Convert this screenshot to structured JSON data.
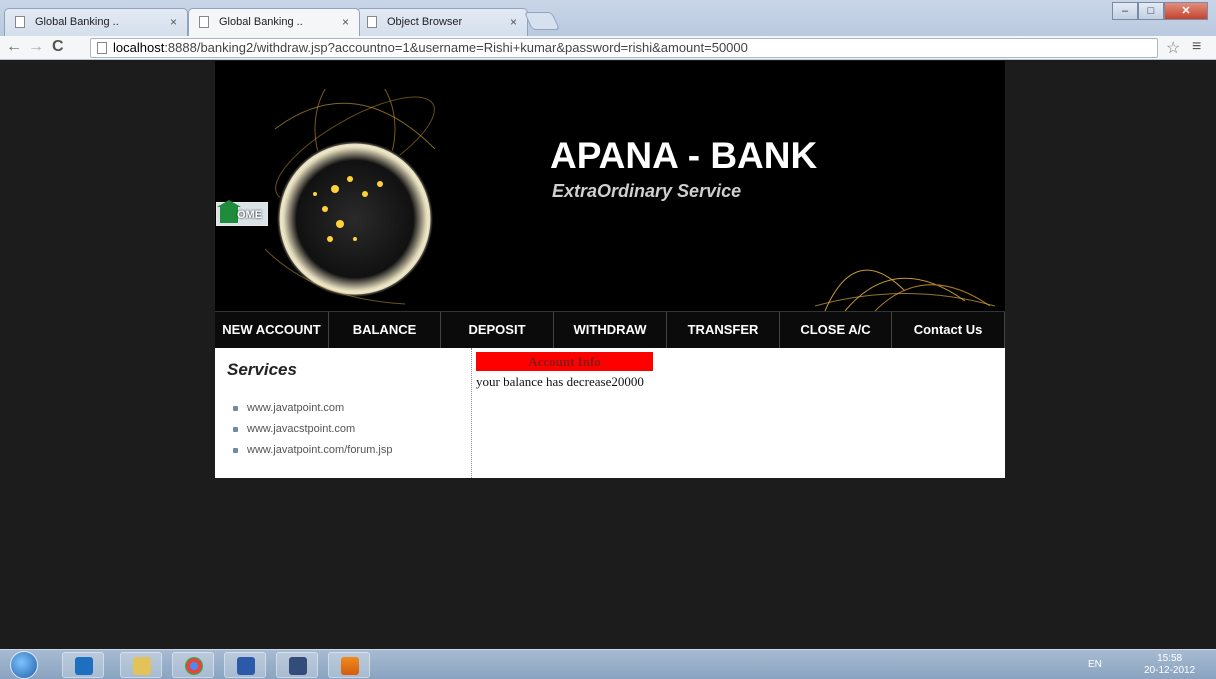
{
  "browser": {
    "tabs": [
      {
        "title": "Global Banking ..",
        "close": "×"
      },
      {
        "title": "Global Banking ..",
        "close": "×"
      },
      {
        "title": "Object Browser",
        "close": "×"
      }
    ],
    "url_host": "localhost",
    "url_rest": ":8888/banking2/withdraw.jsp?accountno=1&username=Rishi+kumar&password=rishi&amount=50000"
  },
  "header": {
    "home_label": "OME",
    "brand": "APANA - BANK",
    "tagline": "ExtraOrdinary Service"
  },
  "menu": {
    "items": [
      "NEW ACCOUNT",
      "BALANCE",
      "DEPOSIT",
      "WITHDRAW",
      "TRANSFER",
      "CLOSE A/C",
      "Contact Us"
    ]
  },
  "services": {
    "title": "Services",
    "links": [
      "www.javatpoint.com",
      "www.javacstpoint.com",
      "www.javatpoint.com/forum.jsp"
    ]
  },
  "account": {
    "title": "Account Info",
    "message": "your balance has decrease20000"
  },
  "taskbar": {
    "lang": "EN",
    "time": "15:58",
    "date": "20-12-2012",
    "apps": [
      "start-orb",
      "outlook",
      "explorer",
      "chrome",
      "word",
      "notepad",
      "vlc"
    ]
  },
  "colors": {
    "accent_red": "#ff0000",
    "page_bg": "#1c1c1c",
    "menu_bg": "#0b0b0b"
  }
}
